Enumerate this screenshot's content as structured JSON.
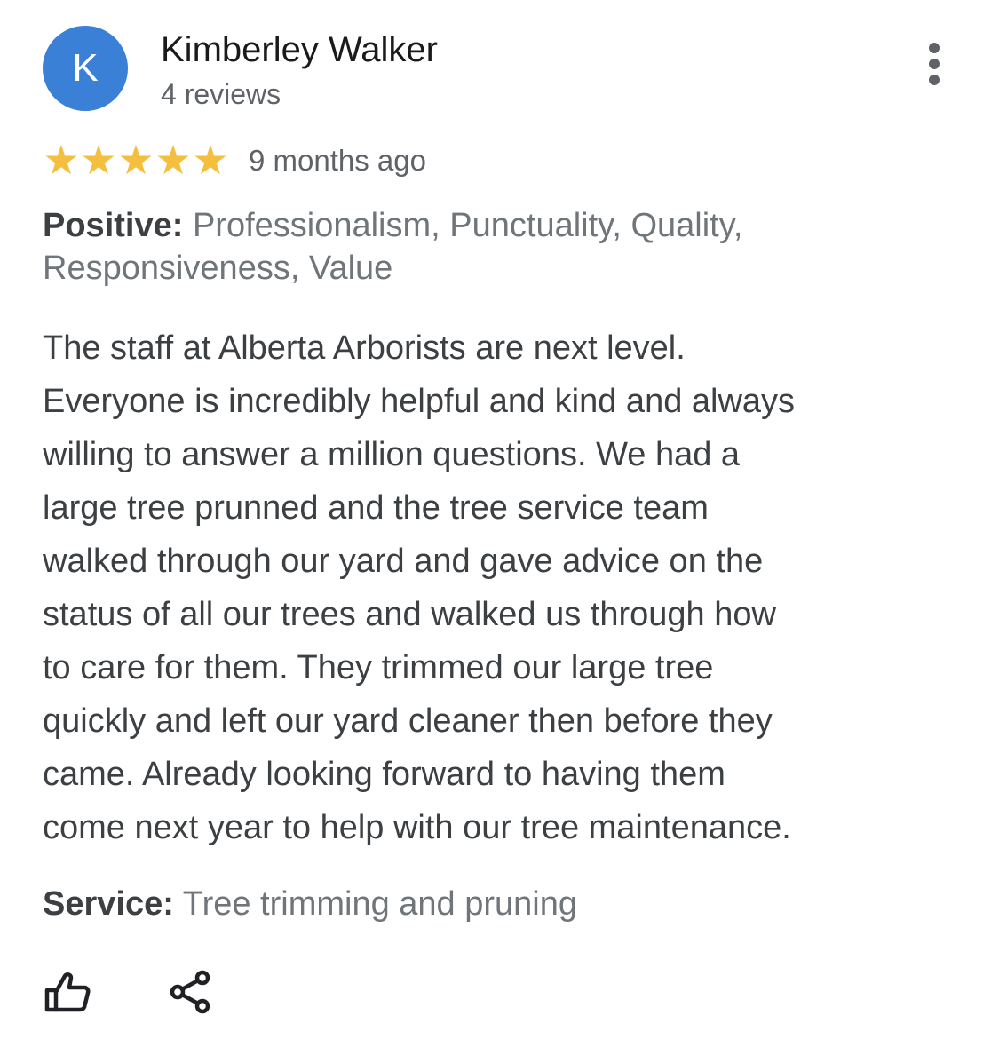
{
  "reviewer": {
    "initial": "K",
    "name": "Kimberley Walker",
    "review_count": "4 reviews",
    "avatar_color": "#3a80d6"
  },
  "rating": {
    "stars": 5,
    "max_stars": 5,
    "star_symbol": "★",
    "star_color": "#f4bf3f",
    "date": "9 months ago"
  },
  "positive": {
    "label": "Positive:",
    "value_line1": " Professionalism, Punctuality, Quality,",
    "value_line2": " Responsiveness, Value"
  },
  "review_text": "The staff at Alberta Arborists are next level.\nEveryone is incredibly helpful and kind and always\nwilling to answer a million questions. We had a\nlarge tree prunned and the tree service team\nwalked through our yard and gave advice on the\nstatus of all our trees and walked us through how\nto care for them. They trimmed our large tree\nquickly and left our yard cleaner then before they\ncame.  Already looking forward to having them\ncome next year to help with our tree maintenance.",
  "service": {
    "label": "Service:",
    "value": " Tree trimming and pruning"
  },
  "actions": {
    "more_icon": "more-vert-icon",
    "like_icon": "thumbs-up-icon",
    "share_icon": "share-icon"
  }
}
